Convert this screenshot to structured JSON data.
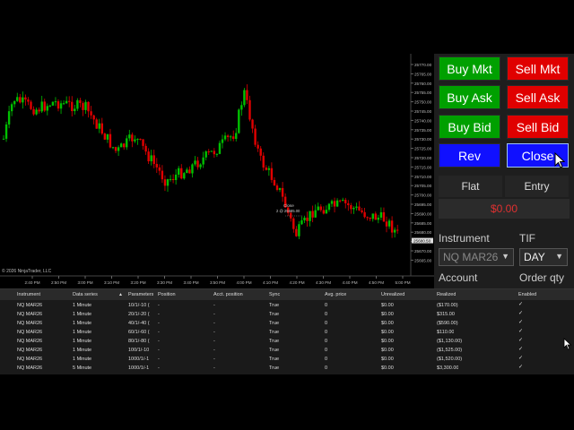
{
  "chart": {
    "copyright": "© 2026 NinjaTrader, LLC",
    "price_labels": [
      "25770.00",
      "25765.00",
      "25760.00",
      "25755.00",
      "25750.00",
      "25745.00",
      "25740.00",
      "25735.00",
      "25730.00",
      "25725.00",
      "25720.00",
      "25715.00",
      "25710.00",
      "25705.00",
      "25700.00",
      "25695.00",
      "25690.00",
      "25685.00",
      "25680.00",
      "25675.00",
      "25670.00",
      "25665.00"
    ],
    "current_price": "25680.50",
    "time_labels": [
      "2:40 PM",
      "2:50 PM",
      "3:00 PM",
      "3:10 PM",
      "3:20 PM",
      "3:30 PM",
      "3:40 PM",
      "3:50 PM",
      "4:00 PM",
      "4:10 PM",
      "4:20 PM",
      "4:30 PM",
      "4:40 PM",
      "4:50 PM",
      "5:00 PM"
    ],
    "annotation_title": "Close",
    "annotation_detail": "2 @ 25685.00",
    "colors": {
      "up": "#00c000",
      "down": "#e00000",
      "background": "#000000"
    }
  },
  "panel": {
    "buy_mkt": "Buy Mkt",
    "sell_mkt": "Sell Mkt",
    "buy_ask": "Buy Ask",
    "sell_ask": "Sell Ask",
    "buy_bid": "Buy Bid",
    "sell_bid": "Sell Bid",
    "rev": "Rev",
    "close": "Close",
    "flat_tab": "Flat",
    "entry_tab": "Entry",
    "pnl": "$0.00",
    "instrument_label": "Instrument",
    "tif_label": "TIF",
    "instrument_value": "NQ MAR26",
    "tif_value": "DAY",
    "account_label": "Account",
    "order_qty_label": "Order qty"
  },
  "grid": {
    "headers": [
      "Instrument",
      "Data series",
      "Parameters",
      "Position",
      "Acct. position",
      "Sync",
      "Avg. price",
      "Unrealized",
      "Realized",
      "Enabled"
    ],
    "rows": [
      [
        "NQ MAR26",
        "1 Minute",
        "10/1/-10 (",
        "-",
        "-",
        "True",
        "0",
        "$0.00",
        "($170.00)"
      ],
      [
        "NQ MAR26",
        "1 Minute",
        "20/1/-20 (",
        "-",
        "-",
        "True",
        "0",
        "$0.00",
        "$315.00"
      ],
      [
        "NQ MAR26",
        "1 Minute",
        "40/1/-40 (",
        "-",
        "-",
        "True",
        "0",
        "$0.00",
        "($590.00)"
      ],
      [
        "NQ MAR26",
        "1 Minute",
        "60/1/-60 (",
        "-",
        "-",
        "True",
        "0",
        "$0.00",
        "$110.00"
      ],
      [
        "NQ MAR26",
        "1 Minute",
        "80/1/-80 (",
        "-",
        "-",
        "True",
        "0",
        "$0.00",
        "($1,130.00)"
      ],
      [
        "NQ MAR26",
        "1 Minute",
        "100/1/-10",
        "-",
        "-",
        "True",
        "0",
        "$0.00",
        "($1,525.00)"
      ],
      [
        "NQ MAR26",
        "1 Minute",
        "1000/1/-1",
        "-",
        "-",
        "True",
        "0",
        "$0.00",
        "($1,520.00)"
      ],
      [
        "NQ MAR26",
        "5 Minute",
        "1000/1/-1",
        "-",
        "-",
        "True",
        "0",
        "$0.00",
        "$3,300.00"
      ]
    ],
    "enabled_mark": "✓"
  }
}
